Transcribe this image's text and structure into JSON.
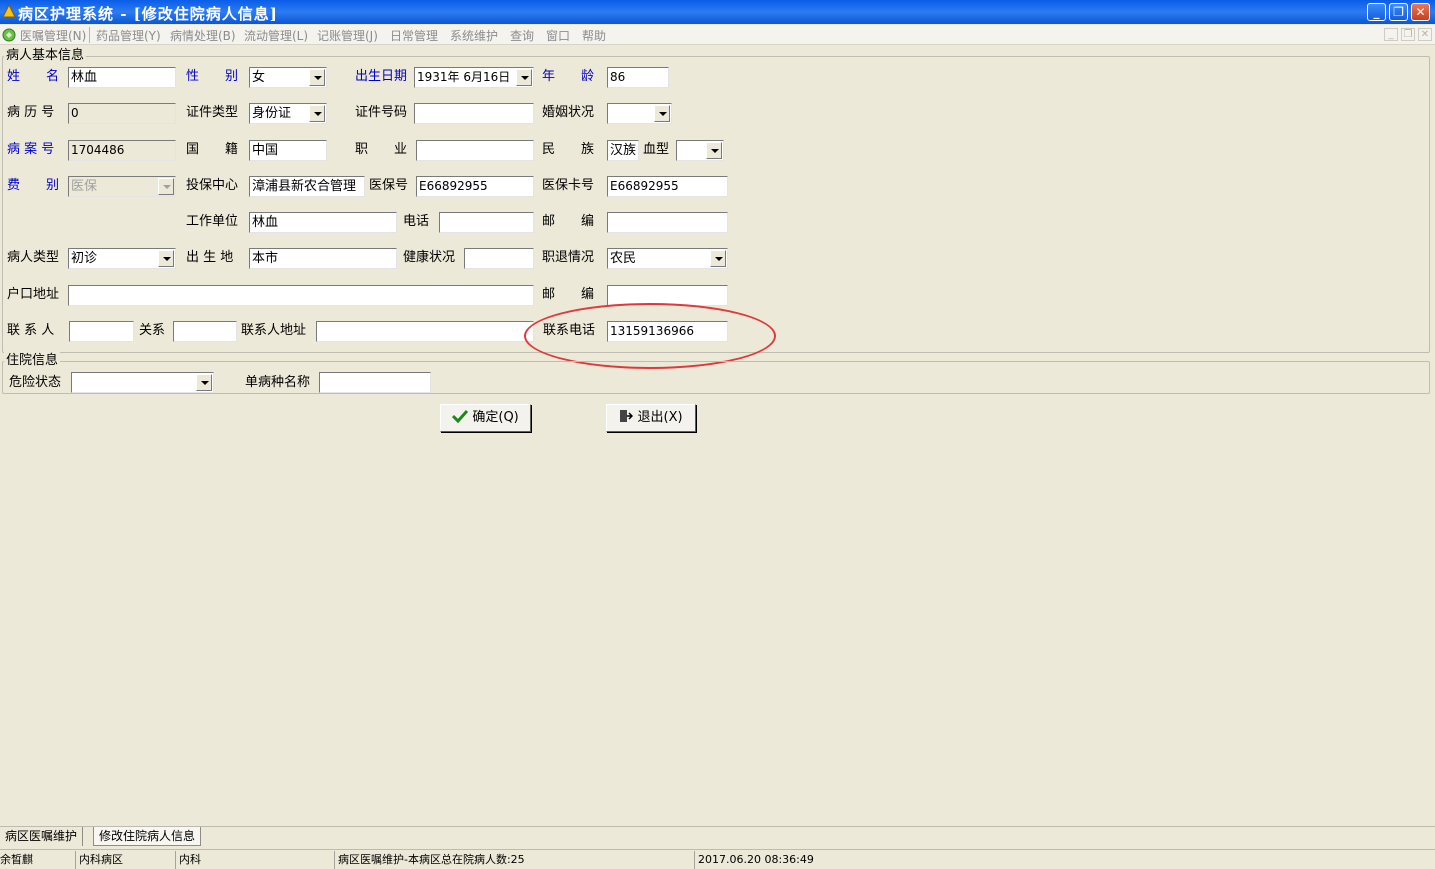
{
  "window": {
    "title": "病区护理系统 - [修改住院病人信息]",
    "buttons": {
      "minimize": "_",
      "restore": "❐",
      "close": "✕"
    }
  },
  "menu": {
    "items": [
      "医嘱管理(N)",
      "药品管理(Y)",
      "病情处理(B)",
      "流动管理(L)",
      "记账管理(J)",
      "日常管理",
      "系统维护",
      "查询",
      "窗口",
      "帮助"
    ]
  },
  "patient_basic": {
    "group_title": "病人基本信息",
    "name_label": "姓　　名",
    "name_value": "林血",
    "sex_label": "性　　别",
    "sex_value": "女",
    "birth_label": "出生日期",
    "birth_value": "1931年  6月16日",
    "age_label": "年　　龄",
    "age_value": "86",
    "record_no_label": "病 历 号",
    "record_no_value": "0",
    "id_type_label": "证件类型",
    "id_type_value": "身份证",
    "id_no_label": "证件号码",
    "id_no_value": "",
    "marital_label": "婚姻状况",
    "marital_value": "",
    "case_no_label": "病 案 号",
    "case_no_value": "1704486",
    "nationality_label": "国　　籍",
    "nationality_value": "中国",
    "occupation_label": "职　　业",
    "occupation_value": "",
    "ethnic_label": "民　　族",
    "ethnic_value": "汉族",
    "blood_label": "血型",
    "blood_value": "",
    "fee_label": "费　　别",
    "fee_value": "医保",
    "insurance_center_label": "投保中心",
    "insurance_center_value": "漳浦县新农合管理",
    "insurance_no_label": "医保号",
    "insurance_no_value": "E66892955",
    "insurance_card_label": "医保卡号",
    "insurance_card_value": "E66892955",
    "work_unit_label": "工作单位",
    "work_unit_value": "林血",
    "phone_label": "电话",
    "phone_value": "",
    "postcode1_label": "邮　　编",
    "postcode1_value": "",
    "patient_type_label": "病人类型",
    "patient_type_value": "初诊",
    "birthplace_label": "出 生 地",
    "birthplace_value": "本市",
    "health_label": "健康状况",
    "health_value": "",
    "retire_label": "职退情况",
    "retire_value": "农民",
    "hukou_label": "户口地址",
    "hukou_value": "",
    "postcode2_label": "邮　　编",
    "postcode2_value": "",
    "contact_label": "联 系 人",
    "contact_value": "",
    "relation_label": "关系",
    "relation_value": "",
    "contact_addr_label": "联系人地址",
    "contact_addr_value": "",
    "contact_phone_label": "联系电话",
    "contact_phone_value": "13159136966"
  },
  "hospital_info": {
    "group_title": "住院信息",
    "danger_label": "危险状态",
    "danger_value": "",
    "disease_label": "单病种名称",
    "disease_value": ""
  },
  "actions": {
    "ok": "确定(Q)",
    "exit": "退出(X)"
  },
  "tabs": [
    "病区医嘱维护",
    "修改住院病人信息"
  ],
  "status": {
    "user": "余晳麒",
    "ward": "内科病区",
    "dept": "内科",
    "message": "病区医嘱维护-本病区总在院病人数:25",
    "datetime": "2017.06.20 08:36:49"
  },
  "colors": {
    "titlebar": "#0a5de8",
    "label_blue": "#0000cc",
    "annotation": "#e0393c"
  }
}
